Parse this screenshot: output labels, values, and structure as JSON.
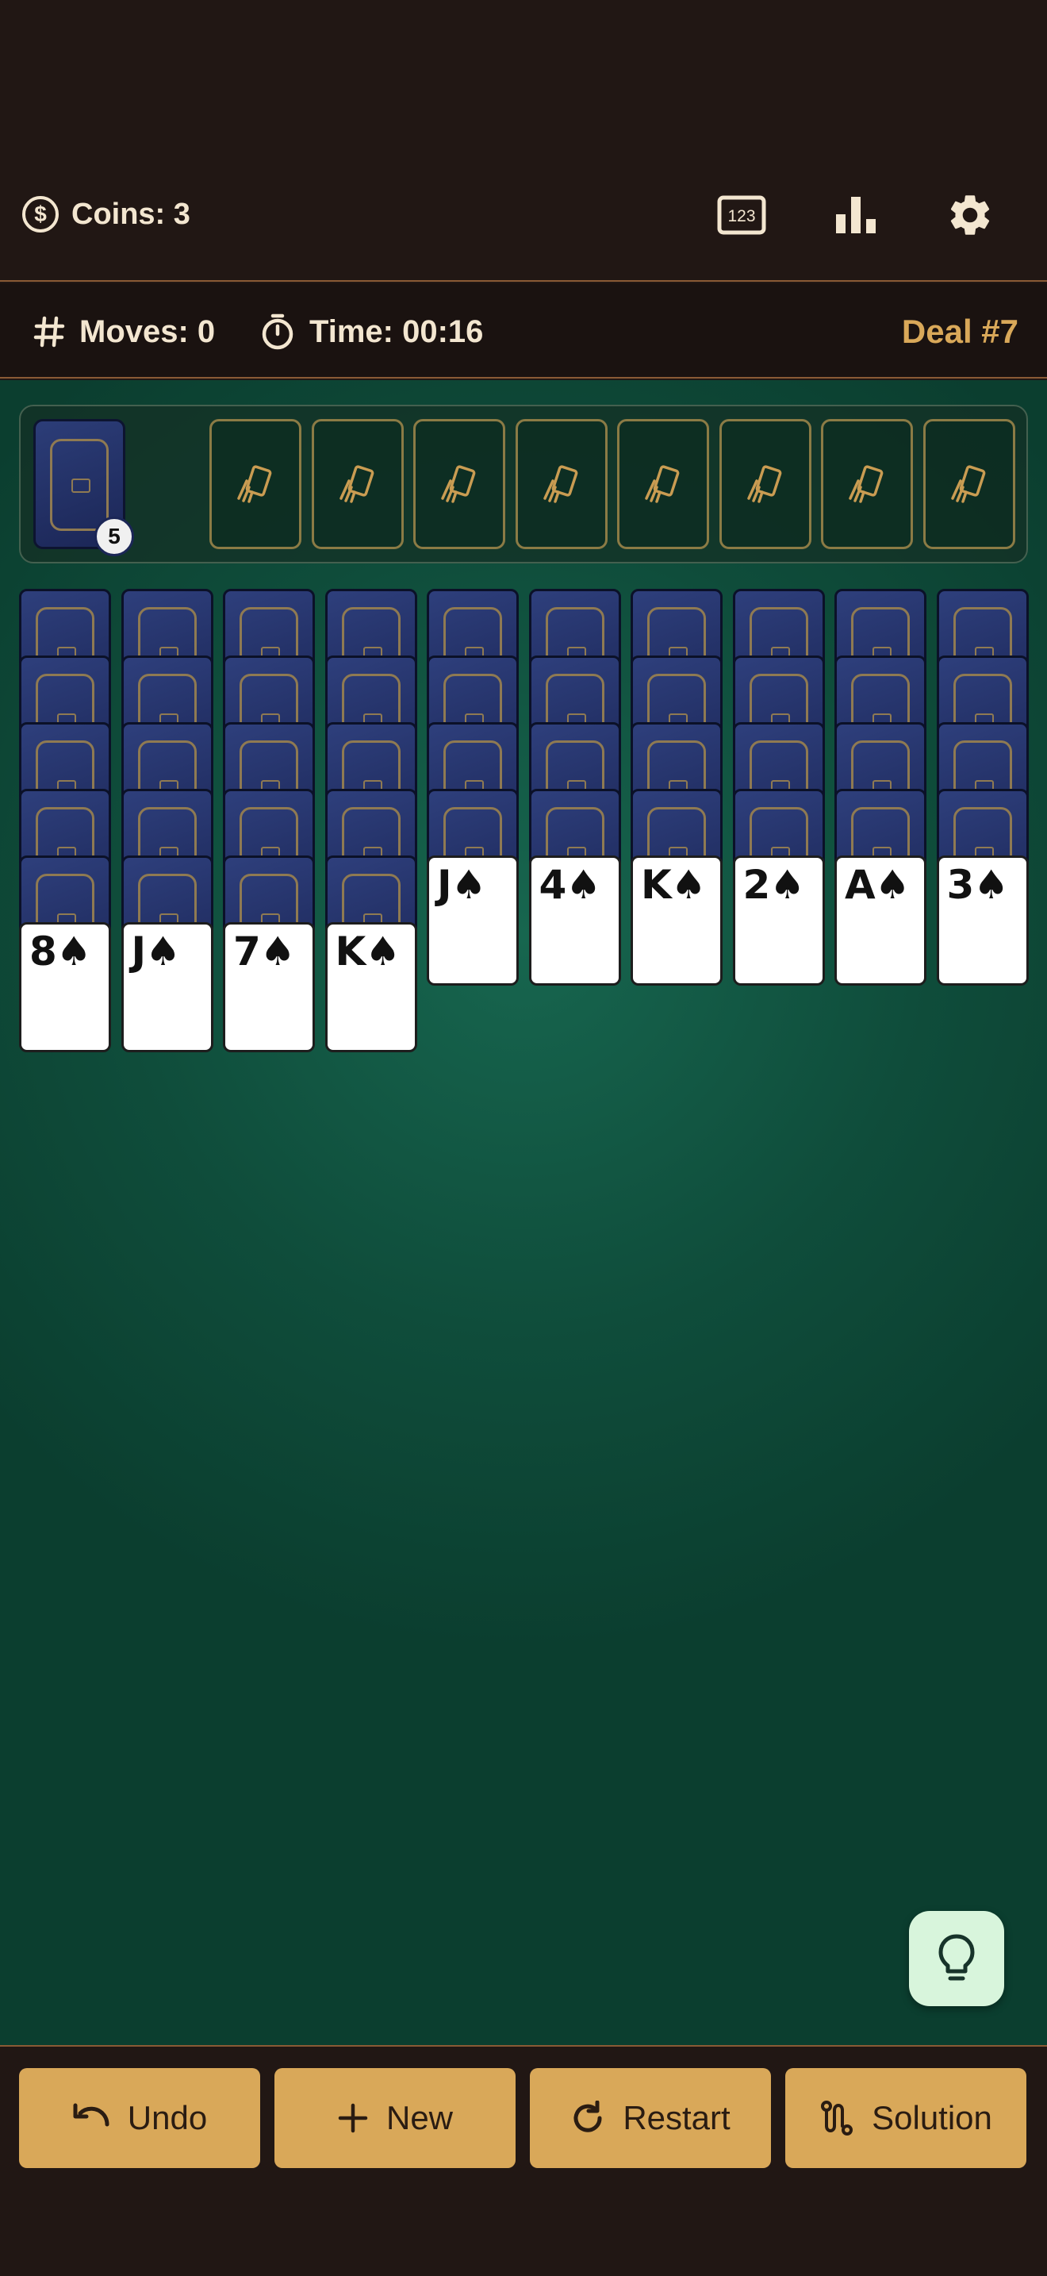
{
  "header": {
    "coins_label": "Coins: 3",
    "coin_icon": "dollar-circle-icon",
    "actions": [
      {
        "name": "number-display-button",
        "icon": "123-icon",
        "text": "123"
      },
      {
        "name": "statistics-button",
        "icon": "bar-chart-icon"
      },
      {
        "name": "settings-button",
        "icon": "gear-icon"
      }
    ]
  },
  "stats": {
    "moves_label": "Moves: 0",
    "time_label": "Time: 00:16",
    "deal_label": "Deal #7"
  },
  "stock": {
    "count": "5"
  },
  "foundations": {
    "count": 8,
    "icon": "empty-card-slot-icon"
  },
  "tableau": [
    {
      "face_down": 5,
      "face_up": [
        "8♠"
      ]
    },
    {
      "face_down": 5,
      "face_up": [
        "J♠"
      ]
    },
    {
      "face_down": 5,
      "face_up": [
        "7♠"
      ]
    },
    {
      "face_down": 5,
      "face_up": [
        "K♠"
      ]
    },
    {
      "face_down": 4,
      "face_up": [
        "J♠"
      ]
    },
    {
      "face_down": 4,
      "face_up": [
        "4♠"
      ]
    },
    {
      "face_down": 4,
      "face_up": [
        "K♠"
      ]
    },
    {
      "face_down": 4,
      "face_up": [
        "2♠"
      ]
    },
    {
      "face_down": 4,
      "face_up": [
        "A♠"
      ]
    },
    {
      "face_down": 4,
      "face_up": [
        "3♠"
      ]
    }
  ],
  "hint": {
    "icon": "lightbulb-icon"
  },
  "footer": {
    "undo_label": "Undo",
    "new_label": "New",
    "restart_label": "Restart",
    "solution_label": "Solution"
  },
  "colors": {
    "header_bg": "#211714",
    "stats_bg": "#1a1210",
    "felt": "#0f4d3b",
    "accent_gold": "#d9a859",
    "card_back": "#1c2758",
    "hint_bg": "#d8f5dc"
  }
}
